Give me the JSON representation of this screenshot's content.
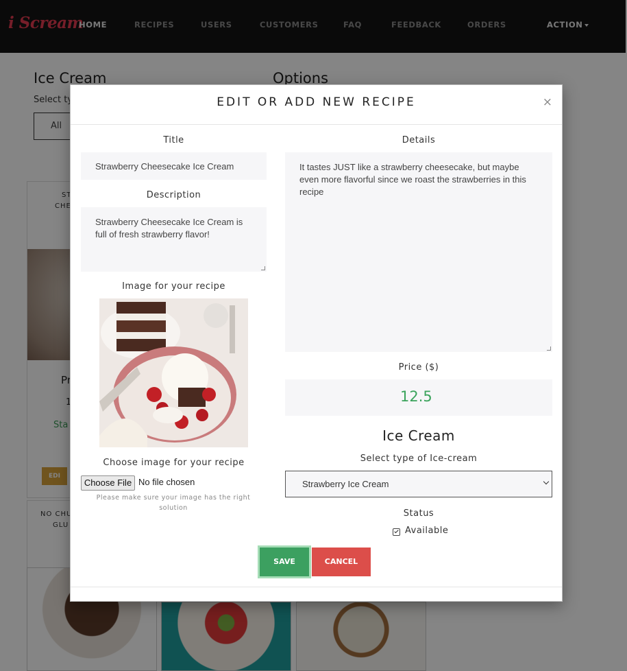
{
  "navbar": {
    "brand": "i Scream",
    "items": [
      {
        "label": "HOME"
      },
      {
        "label": "RECIPES"
      },
      {
        "label": "USERS"
      },
      {
        "label": "CUSTOMERS"
      },
      {
        "label": "FAQ"
      },
      {
        "label": "FEEDBACK"
      },
      {
        "label": "ORDERS"
      }
    ],
    "action_label": "ACTION"
  },
  "background": {
    "title": "Ice Cream",
    "options_title": "Options",
    "select_label": "Select ty",
    "filter_value": "All",
    "card1": {
      "label_line1": "ST",
      "label_line2": "CHE",
      "name": "Pr",
      "price": "1",
      "status": "Sta",
      "edit": "EDI"
    },
    "card2": {
      "label_line1": "NO CHU",
      "label_line2": "GLU"
    }
  },
  "modal": {
    "title": "EDIT OR ADD NEW RECIPE",
    "close": "×",
    "title_label": "Title",
    "title_value": "Strawberry Cheesecake Ice Cream",
    "description_label": "Description",
    "description_value": "Strawberry Cheesecake Ice Cream is full of fresh strawberry flavor!",
    "image_label": "Image for your recipe",
    "choose_image_label": "Choose image for your recipe",
    "choose_file_button": "Choose File",
    "file_status": "No file chosen",
    "image_hint": "Please make sure your image has the right solution",
    "details_label": "Details",
    "details_value": "It tastes JUST like a strawberry cheesecake, but maybe even more flavorful since we roast the strawberries in this recipe",
    "price_label": "Price ($)",
    "price_value": "12.5",
    "section_title": "Ice Cream",
    "select_type_label": "Select type of Ice-cream",
    "select_type_value": "Strawberry Ice Cream",
    "status_label": "Status",
    "available_label": "Available",
    "available_checked": true,
    "save_button": "SAVE",
    "cancel_button": "CANCEL"
  },
  "colors": {
    "brand": "#e23a4f",
    "save": "#3ca060",
    "cancel": "#dc4e4a",
    "price": "#3aa35b",
    "navbar": "#141414"
  }
}
